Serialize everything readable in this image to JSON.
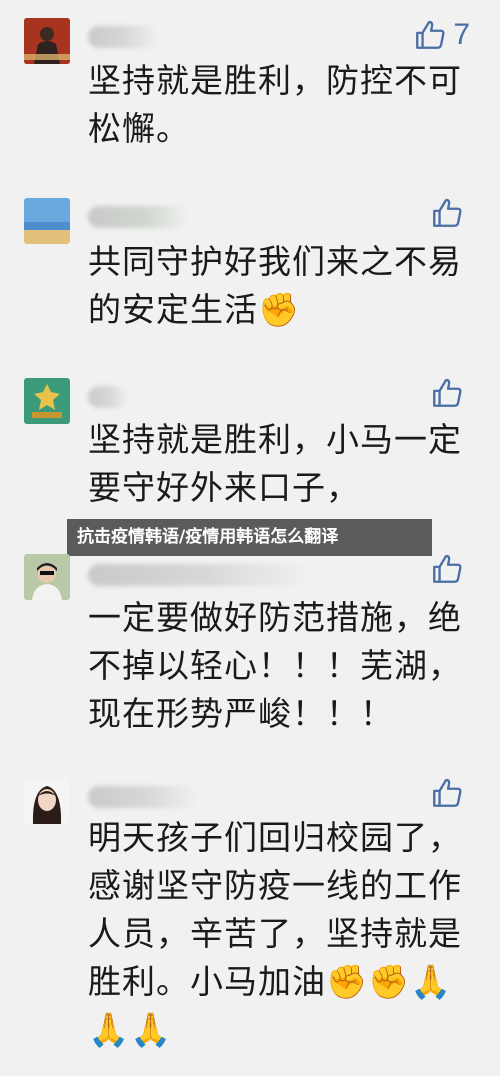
{
  "banner": {
    "title": "抗击疫情韩语/疫情用韩语怎么翻译"
  },
  "comments": [
    {
      "like_count": "7",
      "text": "坚持就是胜利，防控不可松懈。"
    },
    {
      "like_count": "",
      "text": "共同守护好我们来之不易的安定生活✊"
    },
    {
      "like_count": "",
      "text": "坚持就是胜利，小马一定要守好外来口子，"
    },
    {
      "like_count": "",
      "text": "一定要做好防范措施，绝不掉以轻心！！！芜湖，现在形势严峻！！！"
    },
    {
      "like_count": "",
      "text": "明天孩子们回归校园了，感谢坚守防疫一线的工作人员，辛苦了，坚持就是胜利。小马加油✊✊🙏🙏🙏"
    }
  ],
  "colors": {
    "like_accent": "#4a6fa5",
    "banner_bg": "#464646"
  },
  "icons": {
    "like": "thumbs-up-icon"
  }
}
